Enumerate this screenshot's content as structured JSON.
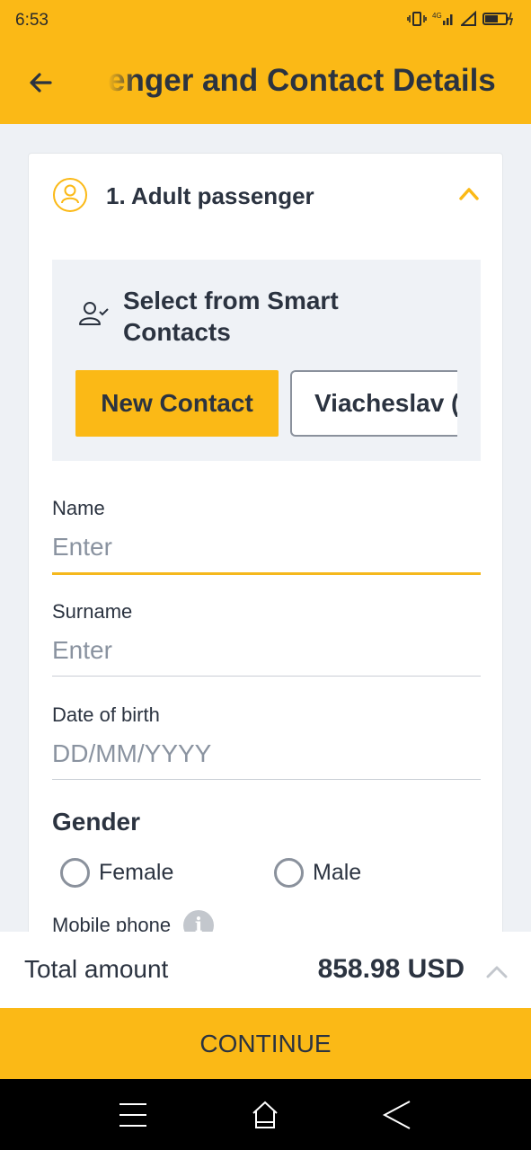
{
  "status_bar": {
    "time": "6:53",
    "icons": [
      "vibrate-icon",
      "4g-signal-icon",
      "signal-icon",
      "battery-icon"
    ]
  },
  "app_bar": {
    "title": "enger and Contact Details",
    "back_icon": "arrow-left-icon"
  },
  "passenger": {
    "title": "1. Adult passenger",
    "smart_contacts": {
      "title": "Select from Smart Contacts",
      "new_contact_label": "New Contact",
      "contact_label": "Viacheslav (",
      "icon": "person-check-icon"
    }
  },
  "form": {
    "name": {
      "label": "Name",
      "placeholder": "Enter"
    },
    "surname": {
      "label": "Surname",
      "placeholder": "Enter"
    },
    "dob": {
      "label": "Date of birth",
      "placeholder": "DD/MM/YYYY"
    },
    "gender": {
      "title": "Gender",
      "female": "Female",
      "male": "Male"
    },
    "mobile": {
      "label": "Mobile phone",
      "info_glyph": "i"
    }
  },
  "total": {
    "label": "Total amount",
    "value": "858.98 USD"
  },
  "continue_label": "CONTINUE",
  "colors": {
    "accent": "#fbb916",
    "text": "#2b3340",
    "placeholder": "#8a93a0"
  }
}
